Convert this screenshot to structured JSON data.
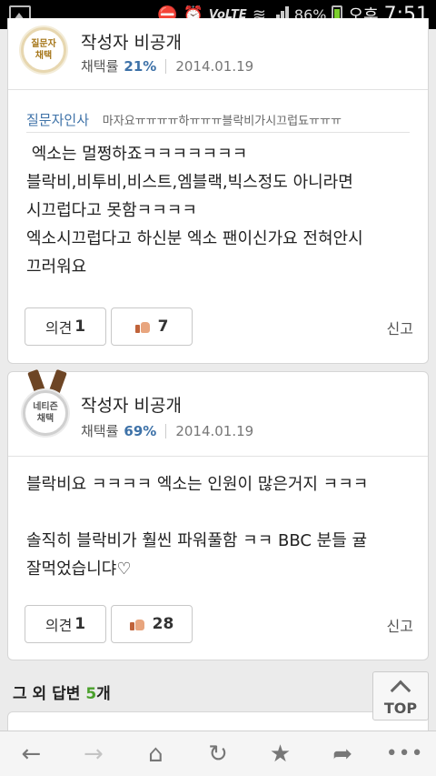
{
  "status_bar": {
    "battery": "86%",
    "ampm": "오후",
    "time": "7:51",
    "network_label": "VoLTE"
  },
  "answers": [
    {
      "badge_line1": "질문자",
      "badge_line2": "채택",
      "author": "작성자 비공개",
      "rate_label": "채택률",
      "rate_value": "21%",
      "date": "2014.01.19",
      "thanks_label": "질문자인사",
      "thanks_text": "마자요ㅠㅠㅠㅠ하ㅠㅠㅠ블락비가시끄럽됴ㅠㅠㅠ",
      "body": " 엑소는 멀쩡하죠ㅋㅋㅋㅋㅋㅋㅋ\n블락비,비투비,비스트,엠블랙,빅스정도 아니라면\n시끄럽다고 못함ㅋㅋㅋㅋ\n엑소시끄럽다고 하신분 엑소 팬이신가요 전혀안시\n끄러워요",
      "comment_label": "의견",
      "comment_count": "1",
      "like_count": "7",
      "report_label": "신고"
    },
    {
      "badge_line1": "네티즌",
      "badge_line2": "채택",
      "author": "작성자 비공개",
      "rate_label": "채택률",
      "rate_value": "69%",
      "date": "2014.01.19",
      "body": "블락비요 ㅋㅋㅋㅋ 엑소는 인원이 많은거지 ㅋㅋㅋ\n\n솔직히 블락비가 훨씬 파워풀함 ㅋㅋ BBC 분들 귤\n잘먹었습니댜♡",
      "comment_label": "의견",
      "comment_count": "1",
      "like_count": "28",
      "report_label": "신고"
    }
  ],
  "others": {
    "prefix": "그 외 답변 ",
    "count": "5",
    "suffix": "개"
  },
  "top_button": {
    "label": "TOP"
  },
  "nav": {
    "back": "←",
    "forward": "→",
    "home": "⌂",
    "refresh": "↻",
    "bookmark": "★",
    "share": "➦",
    "more": "•••"
  },
  "colors": {
    "accent_blue": "#3e72a8",
    "count_green": "#49a02b"
  }
}
